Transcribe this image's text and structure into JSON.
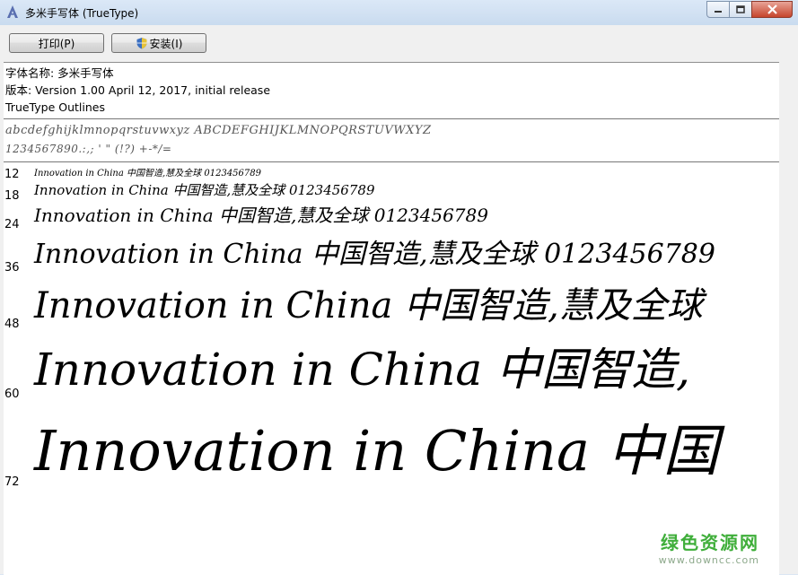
{
  "window": {
    "title": "多米手写体 (TrueType)"
  },
  "toolbar": {
    "print_label": "打印(P)",
    "install_label": "安装(I)"
  },
  "info": {
    "font_name": "字体名称: 多米手写体",
    "version": "版本: Version 1.00 April 12, 2017, initial release",
    "outline_type": "TrueType Outlines"
  },
  "charset": {
    "line1": "abcdefghijklmnopqrstuvwxyz ABCDEFGHIJKLMNOPQRSTUVWXYZ",
    "line2": "1234567890.:,; ' \" (!?) +-*/="
  },
  "samples": [
    {
      "size": "12",
      "text": "Innovation in China 中国智造,慧及全球 0123456789"
    },
    {
      "size": "18",
      "text": "Innovation in China 中国智造,慧及全球 0123456789"
    },
    {
      "size": "24",
      "text": "Innovation in China 中国智造,慧及全球 0123456789"
    },
    {
      "size": "36",
      "text": "Innovation in China 中国智造,慧及全球 0123456789"
    },
    {
      "size": "48",
      "text": "Innovation in China 中国智造,慧及全球"
    },
    {
      "size": "60",
      "text": "Innovation in China 中国智造,"
    },
    {
      "size": "72",
      "text": "Innovation in China 中国"
    }
  ],
  "watermark": {
    "brand": "绿色资源网",
    "url": "www.downcc.com"
  }
}
